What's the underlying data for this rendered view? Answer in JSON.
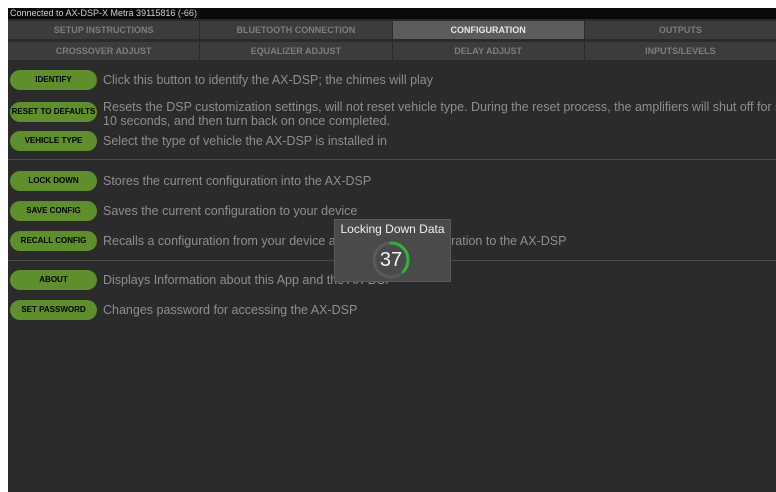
{
  "status": {
    "text": "Connected to AX-DSP-X Metra 39115816 (-66)"
  },
  "tabs_top": [
    {
      "label": "SETUP INSTRUCTIONS"
    },
    {
      "label": "BLUETOOTH CONNECTION"
    },
    {
      "label": "CONFIGURATION"
    },
    {
      "label": "OUTPUTS"
    }
  ],
  "tabs_bottom": [
    {
      "label": "CROSSOVER ADJUST"
    },
    {
      "label": "EQUALIZER ADJUST"
    },
    {
      "label": "DELAY ADJUST"
    },
    {
      "label": "INPUTS/LEVELS"
    }
  ],
  "actions": [
    {
      "button": "IDENTIFY",
      "desc": "Click this button to identify the AX-DSP; the chimes will play"
    },
    {
      "button": "RESET TO DEFAULTS",
      "desc": "Resets the DSP customization settings, will not reset vehicle type. During the reset process, the amplifiers will shut off for 5–",
      "desc2": "10 seconds, and then turn back on once completed."
    },
    {
      "button": "VEHICLE TYPE",
      "desc": "Select the type of vehicle the AX-DSP is installed in"
    },
    {
      "button": "LOCK DOWN",
      "desc": "Stores the current configuration into the AX-DSP"
    },
    {
      "button": "SAVE CONFIG",
      "desc": "Saves the current configuration to your device"
    },
    {
      "button": "RECALL CONFIG",
      "desc": "Recalls a configuration from your device and sends the configuration to the AX-DSP"
    },
    {
      "button": "ABOUT",
      "desc": "Displays Information about this App and the AX-DSP"
    },
    {
      "button": "SET PASSWORD",
      "desc": "Changes password for accessing the AX-DSP"
    }
  ],
  "dialog": {
    "title": "Locking Down Data",
    "progress": 37,
    "ring_color": "#2fb52f"
  },
  "colors": {
    "button": "#5f8e2c",
    "background": "#2b2b2b",
    "active_tab": "#5c5c5c"
  }
}
